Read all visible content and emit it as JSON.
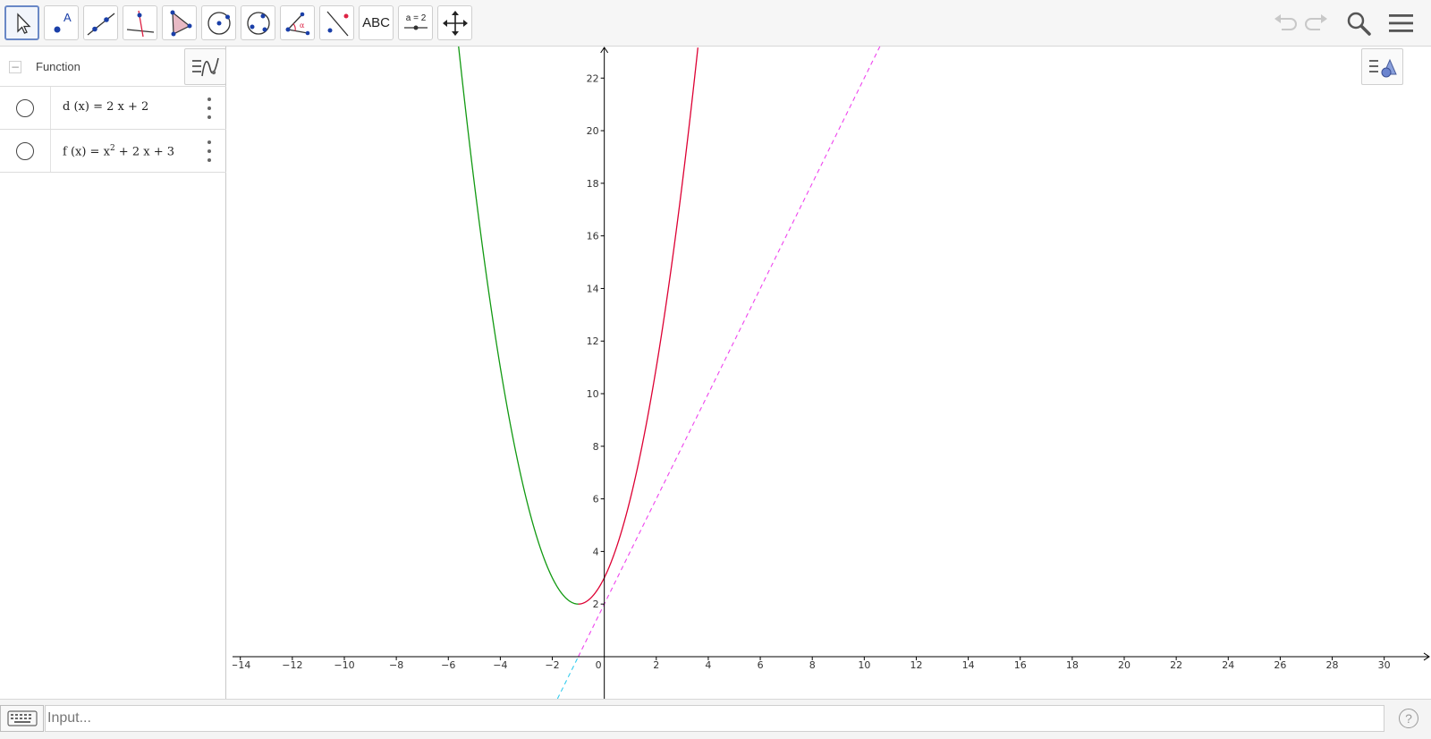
{
  "toolbar": {
    "tools": [
      {
        "name": "move-tool",
        "icon": "arrow-pointer-icon"
      },
      {
        "name": "point-tool",
        "icon": "point-icon",
        "label": "A"
      },
      {
        "name": "line-tool",
        "icon": "line-through-points-icon"
      },
      {
        "name": "perpendicular-line-tool",
        "icon": "perpendicular-line-icon"
      },
      {
        "name": "polygon-tool",
        "icon": "polygon-icon"
      },
      {
        "name": "circle-center-point-tool",
        "icon": "circle-center-icon"
      },
      {
        "name": "circle-three-points-tool",
        "icon": "circle-three-points-icon"
      },
      {
        "name": "angle-tool",
        "icon": "angle-icon",
        "label": "α"
      },
      {
        "name": "reflect-tool",
        "icon": "reflect-about-line-icon"
      },
      {
        "name": "text-tool",
        "icon": "text-icon",
        "label": "ABC"
      },
      {
        "name": "slider-tool",
        "icon": "slider-icon",
        "label": "a = 2"
      },
      {
        "name": "move-graphics-view-tool",
        "icon": "move-view-icon"
      }
    ],
    "undo_icon": "undo-icon",
    "redo_icon": "redo-icon",
    "search_icon": "search-icon",
    "menu_icon": "hamburger-menu-icon"
  },
  "algebra": {
    "group_label": "Function",
    "collapse_symbol": "−",
    "items": [
      {
        "lhs": "d (x)",
        "eq": " = ",
        "rhs": "2 x + 2",
        "color": "#cc33cc"
      },
      {
        "lhs": "f (x)",
        "eq": " = ",
        "rhs_pre": "x",
        "rhs_sup": "2",
        "rhs_post": " + 2 x + 3",
        "color": "#cc0033"
      }
    ]
  },
  "graph": {
    "x_ticks": [
      "−14",
      "−12",
      "−10",
      "−8",
      "−6",
      "−4",
      "−2",
      "0",
      "2",
      "4",
      "6",
      "8",
      "10",
      "12",
      "14",
      "16",
      "18",
      "20",
      "22",
      "24",
      "26",
      "28",
      "30"
    ],
    "y_ticks": [
      "2",
      "4",
      "6",
      "8",
      "10",
      "12",
      "14",
      "16",
      "18",
      "20",
      "22"
    ],
    "x_range": [
      -14.3,
      31.8
    ],
    "y_range": [
      -1.6,
      23.2
    ],
    "colors": {
      "axis": "#000000",
      "f_left": "#119911",
      "f_right": "#dd0033",
      "d_line": "#ee44ee",
      "d_line_low": "#33ccee"
    }
  },
  "chart_data": {
    "type": "line",
    "series": [
      {
        "name": "d (x) = 2 x + 2",
        "x": [
          -1.8,
          10.6
        ],
        "values": [
          -1.6,
          23.2
        ]
      },
      {
        "name": "f (x) = x² + 2 x + 3",
        "x": [
          -5.66,
          -5,
          -4,
          -3,
          -2,
          -1,
          0,
          1,
          2,
          3,
          3.55
        ],
        "values": [
          23.2,
          18,
          11,
          6,
          3,
          2,
          3,
          6,
          11,
          18,
          22.7
        ]
      }
    ],
    "xlim": [
      -14.3,
      31.8
    ],
    "ylim": [
      -1.6,
      23.2
    ]
  },
  "input": {
    "placeholder": "Input...",
    "keyboard_icon": "keyboard-icon",
    "help_label": "?"
  }
}
